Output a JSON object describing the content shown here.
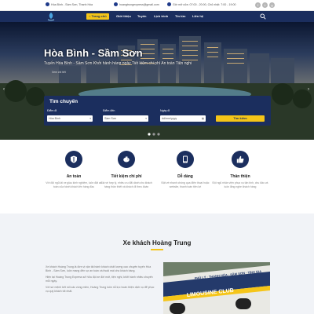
{
  "topbar": {
    "address": "Hòa Bình - Sầm Sơn, Thanh Hóa",
    "email": "hoangtrungexpress@gmail.com",
    "hours": "Giờ mở cửa: 07:00 - 20:00, Chủ nhật: 7:00 - 19:00",
    "socials": [
      {
        "icon": "facebook-icon",
        "glyph": "f"
      },
      {
        "icon": "twitter-icon",
        "glyph": "t"
      },
      {
        "icon": "google-plus-icon",
        "glyph": "g"
      }
    ]
  },
  "nav": {
    "items": [
      {
        "label": "Trang chủ",
        "icon": "home-icon",
        "active": true
      },
      {
        "label": "Giới thiệu",
        "active": false
      },
      {
        "label": "Tuyến",
        "active": false
      },
      {
        "label": "Lịch trình",
        "active": false
      },
      {
        "label": "Tin tức",
        "active": false
      },
      {
        "label": "Liên hệ",
        "active": false
      }
    ]
  },
  "hero": {
    "title": "Hòa Bình - Sầm Sơn",
    "subtitle": "Tuyến Hòa Bình - Sầm Sơn   Khởi hành hàng ngày   Tiết kiệm chi phí   An toàn   Tiện nghi",
    "more": "Xem chi tiết"
  },
  "search": {
    "title": "Tìm chuyến",
    "from_label": "Điểm đi",
    "from_value": "Hòa Bình",
    "to_label": "Điểm đến",
    "to_value": "Sầm Sơn",
    "date_label": "Ngày đi",
    "date_value": "dd/mm/yyyy",
    "button": "Tìm kiếm"
  },
  "features": [
    {
      "icon": "shield-icon",
      "title": "An toàn",
      "desc": "Với đội ngũ lái xe giàu kinh nghiệm, luôn đặt an toàn của hành khách lên hàng đầu"
    },
    {
      "icon": "piggy-bank-icon",
      "title": "Tiết kiệm chi phí",
      "desc": "Giá vé hợp lý, nhiều ưu đãi dành cho khách hàng thân thiết và khách đi theo đoàn"
    },
    {
      "icon": "tablet-icon",
      "title": "Dễ dàng",
      "desc": "Đặt vé nhanh chóng qua điện thoại hoặc website, thanh toán tiện lợi"
    },
    {
      "icon": "thumbs-up-icon",
      "title": "Thân thiện",
      "desc": "Đội ngũ nhân viên phục vụ tận tình, chu đáo và luôn lắng nghe khách hàng"
    }
  ],
  "about": {
    "title": "Xe khách Hoàng Trung",
    "paragraphs": [
      "Xe khách Hoàng Trung là đơn vị vận tải hành khách chất lượng cao chuyên tuyến Hòa Bình - Sầm Sơn, luôn mang đến sự an toàn và thoải mái cho khách hàng.",
      "Hiện tại Hoàng Trung Express sở hữu đội xe đời mới, tiện nghi, khởi hành nhiều chuyến mỗi ngày.",
      "Với sứ mệnh kết nối các vùng miền, Hoàng Trung luôn nỗ lực hoàn thiện dịch vụ để phục vụ quý khách tốt nhất."
    ],
    "bus_text": "LIMOUSINE CLUB",
    "bus_route": "PHỦ LÝ · THANH HÓA · SẦM SƠN · TỈNH GIA"
  },
  "colors": {
    "primary": "#1b2e5e",
    "accent": "#f5c518"
  }
}
